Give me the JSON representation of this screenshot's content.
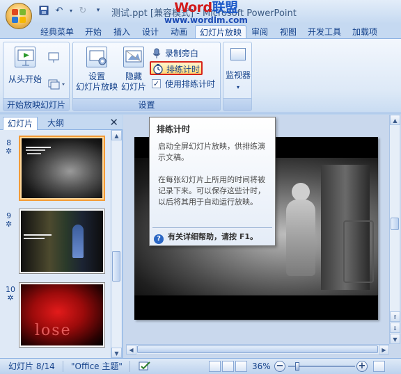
{
  "app": {
    "doc_title": "测试.ppt [兼容模式] - Microsoft PowerPoint",
    "watermark_brand_a": "Word",
    "watermark_brand_b": "联盟",
    "watermark_url": "www.wordlm.com"
  },
  "tabs": [
    {
      "label": "经典菜单"
    },
    {
      "label": "开始"
    },
    {
      "label": "插入"
    },
    {
      "label": "设计"
    },
    {
      "label": "动画"
    },
    {
      "label": "幻灯片放映",
      "active": true
    },
    {
      "label": "审阅"
    },
    {
      "label": "视图"
    },
    {
      "label": "开发工具"
    },
    {
      "label": "加载项"
    }
  ],
  "ribbon": {
    "group_start": {
      "label": "开始放映幻灯片",
      "from_start": "从头开始"
    },
    "group_setup": {
      "label": "设置",
      "setup_show": "设置\n幻灯片放映",
      "hide_slide": "隐藏\n幻灯片",
      "record_narration": "录制旁白",
      "rehearse_timings": "排练计时",
      "use_timings": "使用排练计时",
      "use_timings_checked": true
    },
    "group_monitor": {
      "label": "监视器"
    }
  },
  "left_pane": {
    "tab_slides": "幻灯片",
    "tab_outline": "大纲",
    "close": "✕",
    "slides": [
      {
        "num": "8",
        "selected": true
      },
      {
        "num": "9",
        "selected": false
      },
      {
        "num": "10",
        "selected": false
      }
    ],
    "thumb_text_10": "lose"
  },
  "tooltip": {
    "title": "排练计时",
    "p1": "启动全屏幻灯片放映，供排练演示文稿。",
    "p2": "在每张幻灯片上所用的时间将被记录下来。可以保存这些计时，以后将其用于自动运行放映。",
    "help": "有关详细帮助，请按 F1。"
  },
  "status": {
    "slide_info": "幻灯片 8/14",
    "theme": "\"Office 主题\"",
    "zoom": "36%"
  },
  "colors": {
    "accent": "#15428b",
    "highlight_border": "#d7241b",
    "selected_slide": "#f39b36"
  }
}
